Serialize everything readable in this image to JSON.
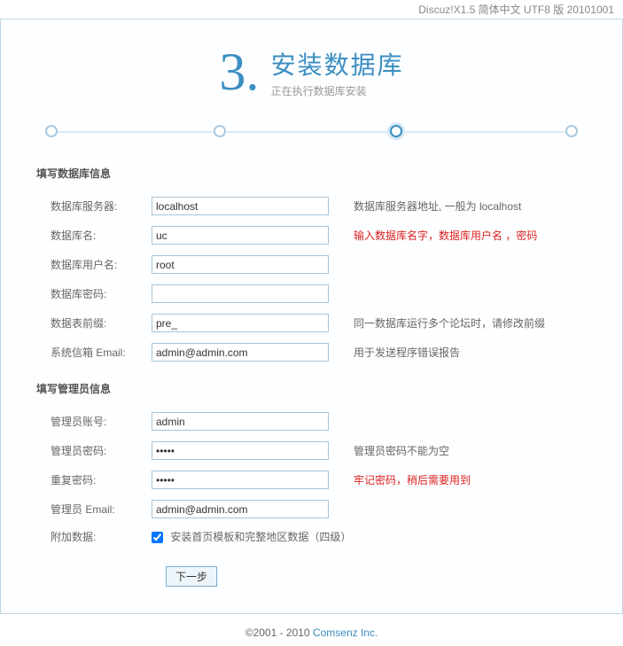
{
  "topbar": "Discuz!X1.5 简体中文 UTF8 版 20101001",
  "header": {
    "num": "3.",
    "title": "安装数据库",
    "subtitle": "正在执行数据库安装"
  },
  "section1_title": "填写数据库信息",
  "section2_title": "填写管理员信息",
  "db": {
    "host_label": "数据库服务器:",
    "host_value": "localhost",
    "host_hint": "数据库服务器地址, 一般为 localhost",
    "name_label": "数据库名:",
    "name_value": "uc",
    "name_hint": "输入数据库名字，数据库用户名 ，密码",
    "user_label": "数据库用户名:",
    "user_value": "root",
    "pass_label": "数据库密码:",
    "pass_value": "",
    "prefix_label": "数据表前缀:",
    "prefix_value": "pre_",
    "prefix_hint": "同一数据库运行多个论坛时，请修改前缀",
    "email_label": "系统信箱 Email:",
    "email_value": "admin@admin.com",
    "email_hint": "用于发送程序错误报告"
  },
  "admin": {
    "user_label": "管理员账号:",
    "user_value": "admin",
    "pass_label": "管理员密码:",
    "pass_value": "•••••",
    "pass_hint": "管理员密码不能为空",
    "pass2_label": "重复密码:",
    "pass2_value": "•••••",
    "pass2_hint": "牢记密码，稍后需要用到",
    "email_label": "管理员 Email:",
    "email_value": "admin@admin.com",
    "extra_label": "附加数据:",
    "extra_text": "安装首页模板和完整地区数据（四级）"
  },
  "next_btn": "下一步",
  "footer": {
    "copy": "©2001 - 2010 ",
    "link": "Comsenz Inc."
  }
}
